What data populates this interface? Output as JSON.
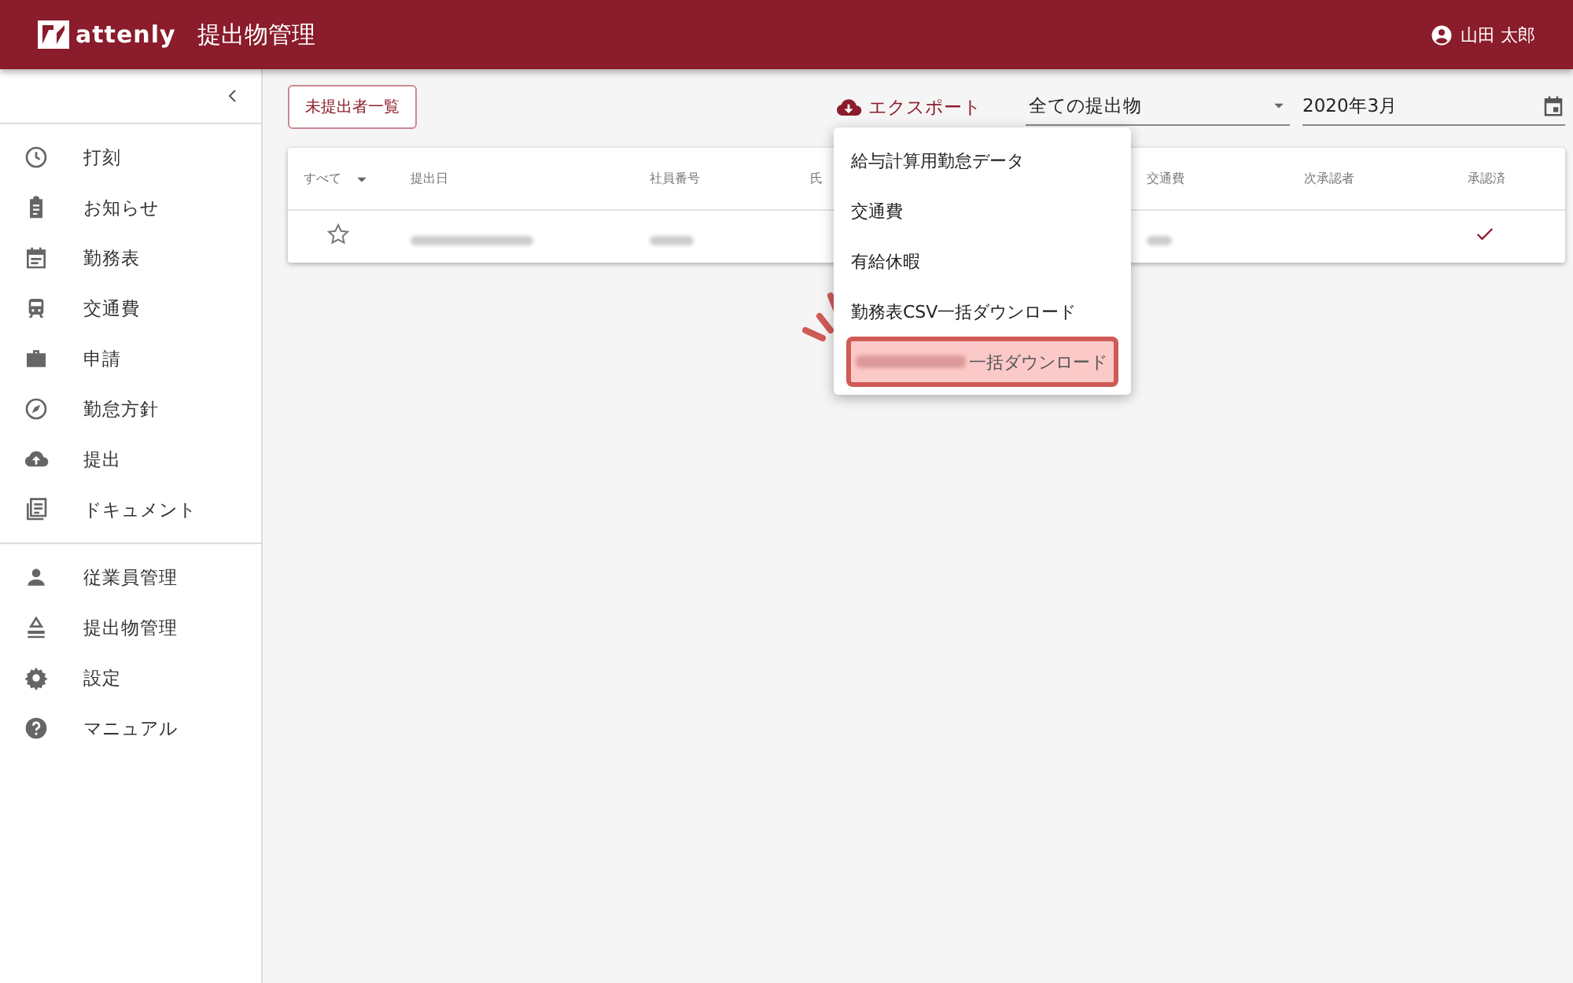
{
  "header": {
    "logo": "attenly",
    "title": "提出物管理",
    "user": "山田 太郎"
  },
  "sidebar": {
    "groups": [
      [
        {
          "label": "打刻"
        },
        {
          "label": "お知らせ"
        },
        {
          "label": "勤務表"
        },
        {
          "label": "交通費"
        },
        {
          "label": "申請"
        },
        {
          "label": "勤怠方針"
        },
        {
          "label": "提出"
        },
        {
          "label": "ドキュメント"
        }
      ],
      [
        {
          "label": "従業員管理"
        },
        {
          "label": "提出物管理"
        },
        {
          "label": "設定"
        },
        {
          "label": "マニュアル"
        }
      ]
    ]
  },
  "toolbar": {
    "unsubmitted_button": "未提出者一覧",
    "export_button": "エクスポート",
    "filter": {
      "value": "全ての提出物"
    },
    "month": {
      "value": "2020年3月"
    }
  },
  "table": {
    "filter_label": "すべて",
    "columns": [
      "提出日",
      "社員番号",
      "氏",
      "交通費",
      "次承認者",
      "承認済"
    ],
    "rows": [
      {
        "starred": false,
        "approved": true
      }
    ]
  },
  "export_menu": {
    "items": [
      {
        "label": "給与計算用勤怠データ",
        "highlighted": false,
        "redacted": false
      },
      {
        "label": "交通費",
        "highlighted": false,
        "redacted": false
      },
      {
        "label": "有給休暇",
        "highlighted": false,
        "redacted": false
      },
      {
        "label": "勤務表CSV一括ダウンロード",
        "highlighted": false,
        "redacted": false
      },
      {
        "label": "一括ダウンロード",
        "highlighted": true,
        "redacted": true
      }
    ]
  }
}
